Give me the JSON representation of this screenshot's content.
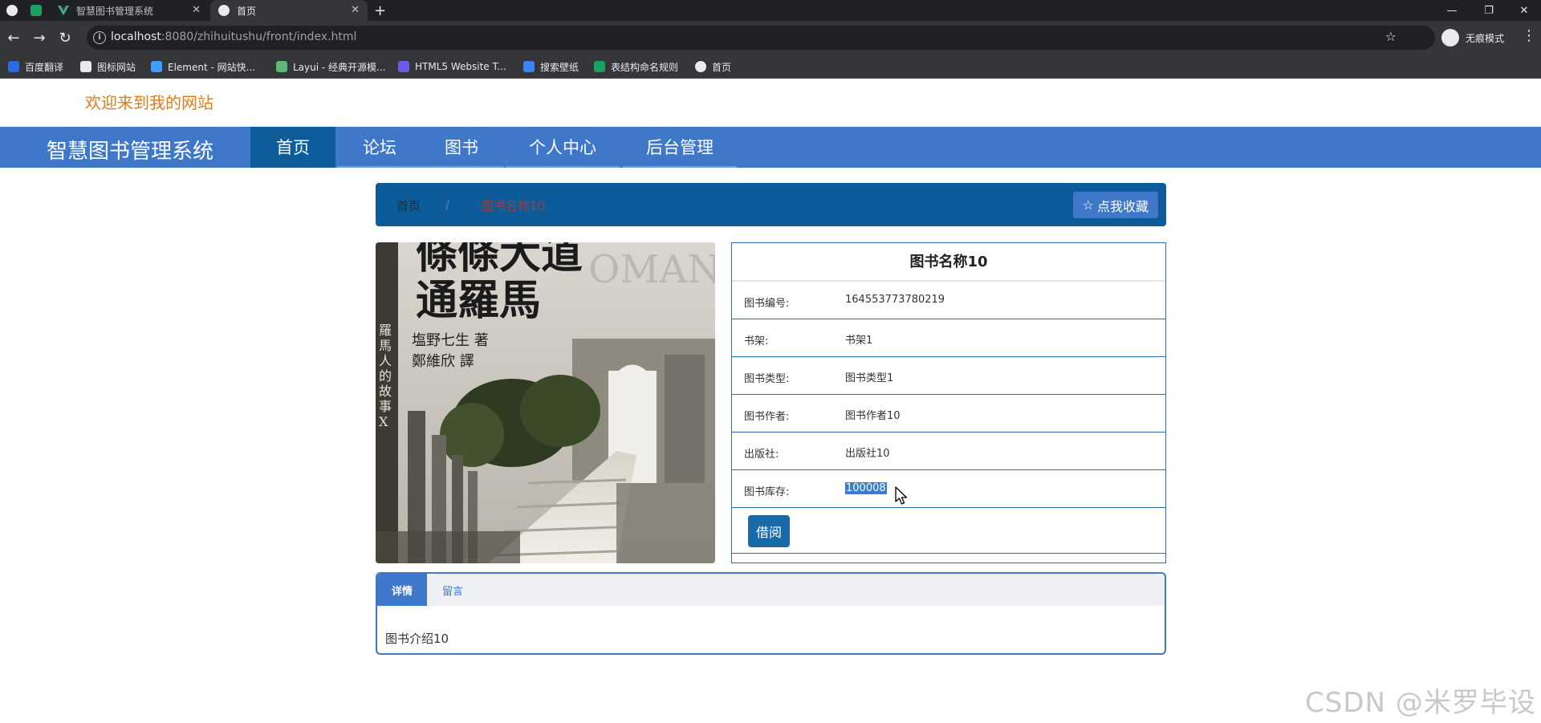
{
  "browser": {
    "tabs": [
      {
        "title": ""
      },
      {
        "title": ""
      },
      {
        "title": "智慧图书管理系统"
      },
      {
        "title": "首页"
      }
    ],
    "new_tab": "+",
    "url_host": "localhost",
    "url_rest": ":8080/zhihuitushu/front/index.html",
    "incognito_label": "无痕模式",
    "bookmarks": [
      "百度翻译",
      "图标网站",
      "Element - 网站快...",
      "Layui - 经典开源模...",
      "HTML5 Website T...",
      "搜索壁纸",
      "表结构命名规则",
      "首页"
    ],
    "colors": {
      "chrome_dark": "#202124",
      "chrome_toolbar": "#35363a"
    }
  },
  "site": {
    "welcome": "欢迎来到我的网站",
    "brand": "智慧图书管理系统",
    "nav": [
      "首页",
      "论坛",
      "图书",
      "个人中心",
      "后台管理"
    ],
    "colors": {
      "nav_bg": "#3f78c9",
      "nav_active": "#0f5c9b",
      "welcome": "#e07b1c"
    }
  },
  "breadcrumb": {
    "home": "首页",
    "separator": "/",
    "current": "图书名称10",
    "favorite_button": "点我收藏"
  },
  "book": {
    "title": "图书名称10",
    "fields": [
      {
        "label": "图书编号:",
        "value": "164553773780219"
      },
      {
        "label": "书架:",
        "value": "书架1"
      },
      {
        "label": "图书类型:",
        "value": "图书类型1"
      },
      {
        "label": "图书作者:",
        "value": "图书作者10"
      },
      {
        "label": "出版社:",
        "value": "出版社10"
      },
      {
        "label": "图书库存:",
        "value": "100008"
      }
    ],
    "borrow_button": "借阅",
    "cover": {
      "title_lines": [
        "條條大道",
        "通羅馬"
      ],
      "author_lines": [
        "塩野七生 著",
        "鄭維欣 譯"
      ],
      "series": "羅馬人的故事X",
      "corner_text": "OMAN"
    }
  },
  "detail_tabs": {
    "tabs": [
      "详情",
      "留言"
    ],
    "active": "详情",
    "content": "图书介绍10"
  },
  "watermark": "CSDN @米罗毕设"
}
